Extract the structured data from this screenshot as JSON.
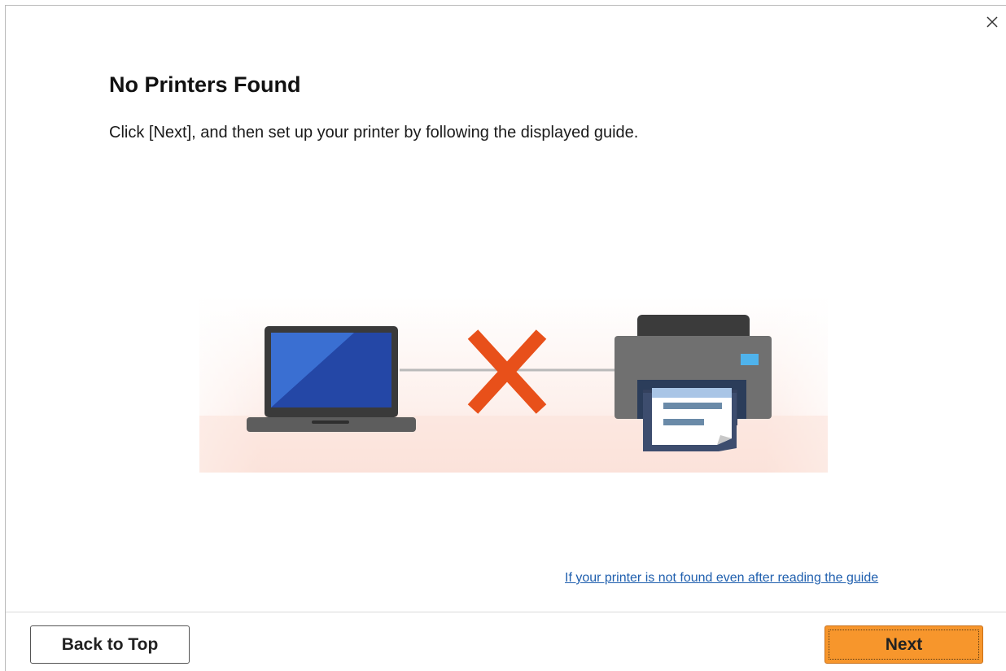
{
  "dialog": {
    "title": "No Printers Found",
    "instruction": "Click [Next], and then set up your printer by following the displayed guide.",
    "help_link": "If your printer is not found even after reading the guide"
  },
  "illustration": {
    "laptop": "laptop-icon",
    "connection": "no-connection-x-icon",
    "printer": "printer-icon",
    "colors": {
      "x_mark": "#e8501a",
      "laptop_screen": "#2f5fc4",
      "printer_body": "#6e6e6e"
    }
  },
  "footer": {
    "back_label": "Back to Top",
    "next_label": "Next"
  },
  "icons": {
    "close": "close-icon"
  },
  "colors": {
    "accent": "#f7962c",
    "link": "#1f5fae"
  }
}
